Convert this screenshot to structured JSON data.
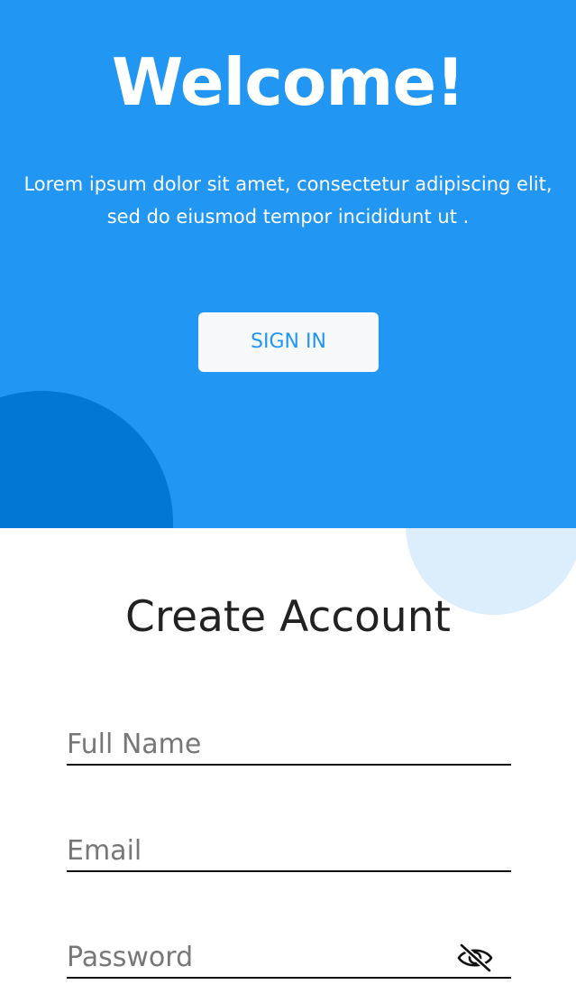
{
  "hero": {
    "title": "Welcome!",
    "text": "Lorem ipsum dolor sit amet, consectetur adipiscing elit, sed do eiusmod tempor incididunt ut .",
    "signin_label": "SIGN IN"
  },
  "form": {
    "title": "Create Account",
    "full_name_placeholder": "Full Name",
    "email_placeholder": "Email",
    "password_placeholder": "Password",
    "password_toggle_icon": "eye-off-icon"
  },
  "colors": {
    "primary": "#2196F3",
    "primary_dark": "#0277D3",
    "light_accent": "#DCEEFC",
    "button_bg": "#F6F8FA"
  }
}
